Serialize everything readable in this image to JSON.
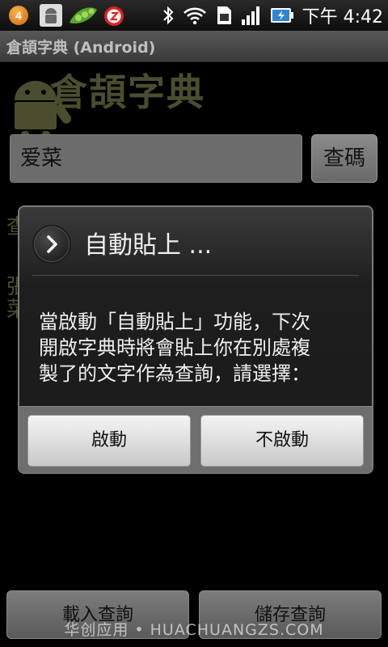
{
  "status_bar": {
    "notification_count": "4",
    "time": "下午 4:42",
    "icons": [
      "notification-badge-icon",
      "android-debug-icon",
      "pea-pod-icon",
      "alarm-clock-icon",
      "bluetooth-icon",
      "wifi-icon",
      "sim-card-icon",
      "signal-icon",
      "battery-charging-icon"
    ]
  },
  "app_bar": {
    "title": "倉頡字典 (Android)"
  },
  "app": {
    "logo_text": "倉頡字典",
    "search_value": "爱菜",
    "search_button": "查碼",
    "background_glyphs": [
      "查",
      "張",
      "菜"
    ]
  },
  "dialog": {
    "title": "自動貼上 ...",
    "message_lines": [
      "當啟動「自動貼上」功能，下次",
      "開啟字典時將會貼上你在別處複",
      "製了的文字作為查詢，請選擇："
    ],
    "buttons": {
      "enable": "啟動",
      "disable": "不啟動"
    }
  },
  "bottom_buttons": {
    "load": "載入查詢",
    "save": "儲存查詢"
  },
  "watermark": "华创应用 • HUACHUANGZS.COM",
  "colors": {
    "dialog_border": "#7a7a7a",
    "logo_text": "#4b4d2e",
    "dialog_text": "#f0f0f0"
  }
}
